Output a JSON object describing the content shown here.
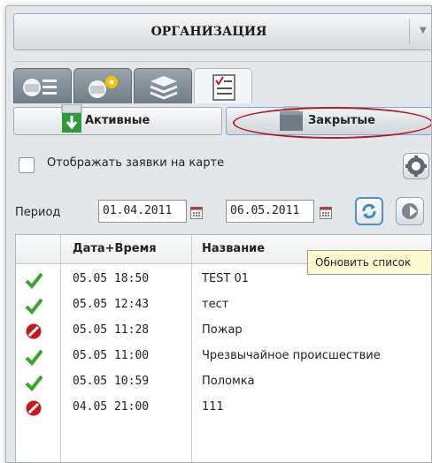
{
  "header": {
    "title": "ОРГАНИЗАЦИЯ"
  },
  "icon_tabs": [
    {
      "icon": "vehicles-list-icon"
    },
    {
      "icon": "vehicles-location-icon"
    },
    {
      "icon": "layers-icon"
    },
    {
      "icon": "requests-checklist-icon",
      "active": true
    }
  ],
  "sub_tabs": {
    "active_label": "Активные",
    "closed_label": "Закрытые",
    "selected": "Закрытые"
  },
  "map_option": {
    "label": "Отображать заявки на карте",
    "checked": false
  },
  "period": {
    "label": "Период",
    "from": "01.04.2011",
    "to": "06.05.2011"
  },
  "tooltip": "Обновить список",
  "table": {
    "columns": [
      "Дата+Время",
      "Название"
    ],
    "rows": [
      {
        "status": "done",
        "datetime": "05.05 18:50",
        "name": "TEST 01"
      },
      {
        "status": "done",
        "datetime": "05.05 12:43",
        "name": "тест"
      },
      {
        "status": "cancelled",
        "datetime": "05.05 11:28",
        "name": "Пожар"
      },
      {
        "status": "done",
        "datetime": "05.05 11:00",
        "name": "Чрезвычайное происшествие"
      },
      {
        "status": "done",
        "datetime": "05.05 10:59",
        "name": "Поломка"
      },
      {
        "status": "cancelled",
        "datetime": "04.05 21:00",
        "name": "111"
      }
    ]
  },
  "colors": {
    "done": "#3aa52b",
    "cancelled": "#c8171b",
    "highlight": "#b01f24",
    "accent": "#4d8fd6"
  }
}
